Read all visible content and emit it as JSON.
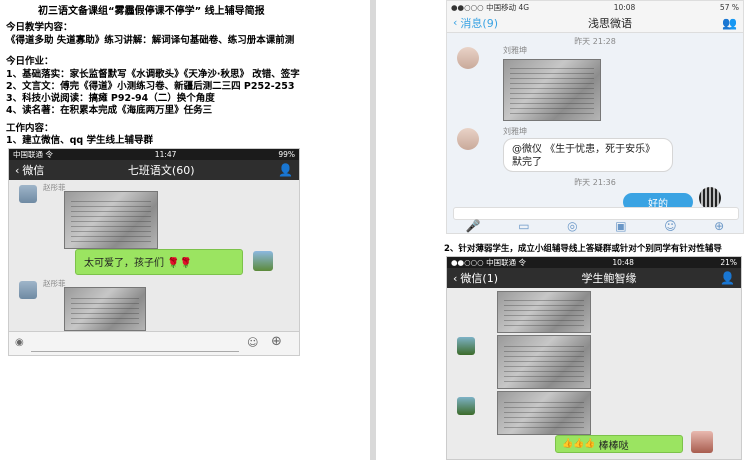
{
  "doc": {
    "title": "初三语文备课组“雾霾假停课不停学” 线上辅导简报",
    "today_content_heading": "今日教学内容：",
    "today_content_line": "《得道多助 失道寡助》练习讲解：解词译句基础卷、练习册本课前测",
    "homework_heading": "今日作业：",
    "homework_items": [
      "1、基础落实：家长监督默写《水调歌头》《天净沙·秋思》 改错、签字",
      "2、文言文：傅完《得道》小测练习卷、新疆后测二三四 P252-253",
      "3、科技小说阅读：搞瘫 P92-94（二）换个角度",
      "4、读名著：在积累本完成《海底两万里》任务三"
    ],
    "work_heading": "工作内容：",
    "work_item1": "1、建立微信、qq 学生线上辅导群",
    "work_item2": "2、针对薄弱学生，成立小组辅导线上答疑群或针对个别同学有针对性辅导"
  },
  "phone1": {
    "status_left": "中国联通 令",
    "status_time": "11:47",
    "status_right": "99%",
    "back_label": "微信",
    "title": "七班语文(60)",
    "sender1": "赵彤菲",
    "message": "太可爱了，孩子们",
    "sender2": "赵彤菲"
  },
  "phone2": {
    "status_left": "●●○○○ 中国移动 4G",
    "status_time": "10:08",
    "status_right": "57 %",
    "back_label": "消息(9)",
    "title": "浅思微语",
    "time1": "昨天 21:28",
    "sender1": "刘雅坤",
    "sender2": "刘雅坤",
    "message": "@微仪 《生于忧患，死于安乐》默完了",
    "time2": "昨天 21:36",
    "reply": "好的"
  },
  "phone3": {
    "status_left": "●●○○○ 中国联通 令",
    "status_time": "10:48",
    "status_right": "21%",
    "back_label": "微信(1)",
    "title": "学生鲍智缘",
    "reply": "棒棒哒"
  }
}
